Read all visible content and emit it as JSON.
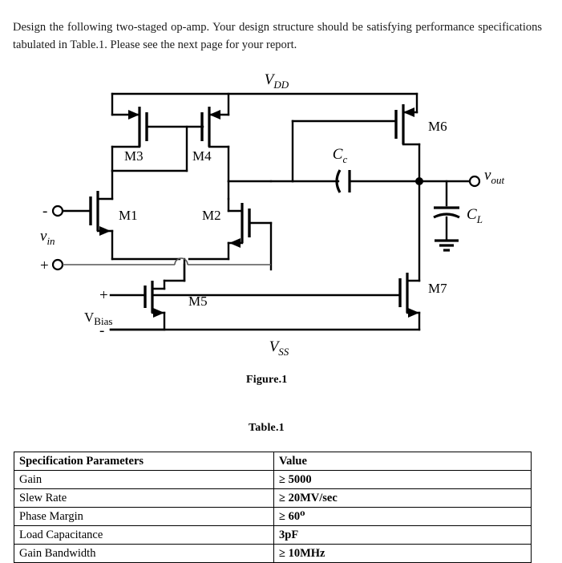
{
  "prompt": {
    "text": "Design the following two-staged op-amp. Your design structure should be satisfying performance specifications tabulated in Table.1. Please see the next page for your report."
  },
  "figure": {
    "caption": "Figure.1",
    "rails": {
      "vdd_label": "V",
      "vdd_sub": "DD",
      "vss_label": "V",
      "vss_sub": "SS"
    },
    "transistors": [
      {
        "name": "M3"
      },
      {
        "name": "M4"
      },
      {
        "name": "M1"
      },
      {
        "name": "M2"
      },
      {
        "name": "M5"
      },
      {
        "name": "M6"
      },
      {
        "name": "M7"
      }
    ],
    "components": {
      "cc_label": "C",
      "cc_sub": "c",
      "cl_label": "C",
      "cl_sub": "L"
    },
    "ports": {
      "vin_label": "v",
      "vin_sub": "in",
      "vin_minus": "-",
      "vin_plus": "+",
      "vout_label": "v",
      "vout_sub": "out",
      "vbias_label": "V",
      "vbias_sub": "Bias",
      "vbias_plus": "+",
      "vbias_minus": "-"
    },
    "icons": {
      "ground": "ground-icon",
      "junction": "junction-dot-icon",
      "wire_hop": "wire-hop-icon"
    }
  },
  "table": {
    "caption": "Table.1",
    "columns": [
      "Specification Parameters",
      "Value"
    ],
    "rows": [
      {
        "parameter": "Gain",
        "value": "≥ 5000"
      },
      {
        "parameter": "Slew Rate",
        "value": "≥ 20MV/sec"
      },
      {
        "parameter": "Phase Margin",
        "value": "≥ 60⁰"
      },
      {
        "parameter": "Load Capacitance",
        "value": "3pF"
      },
      {
        "parameter": "Gain Bandwidth",
        "value": "≥ 10MHz"
      }
    ]
  },
  "colors": {
    "ink": "#000000",
    "paper": "#ffffff",
    "faint_wire": "#555555"
  }
}
